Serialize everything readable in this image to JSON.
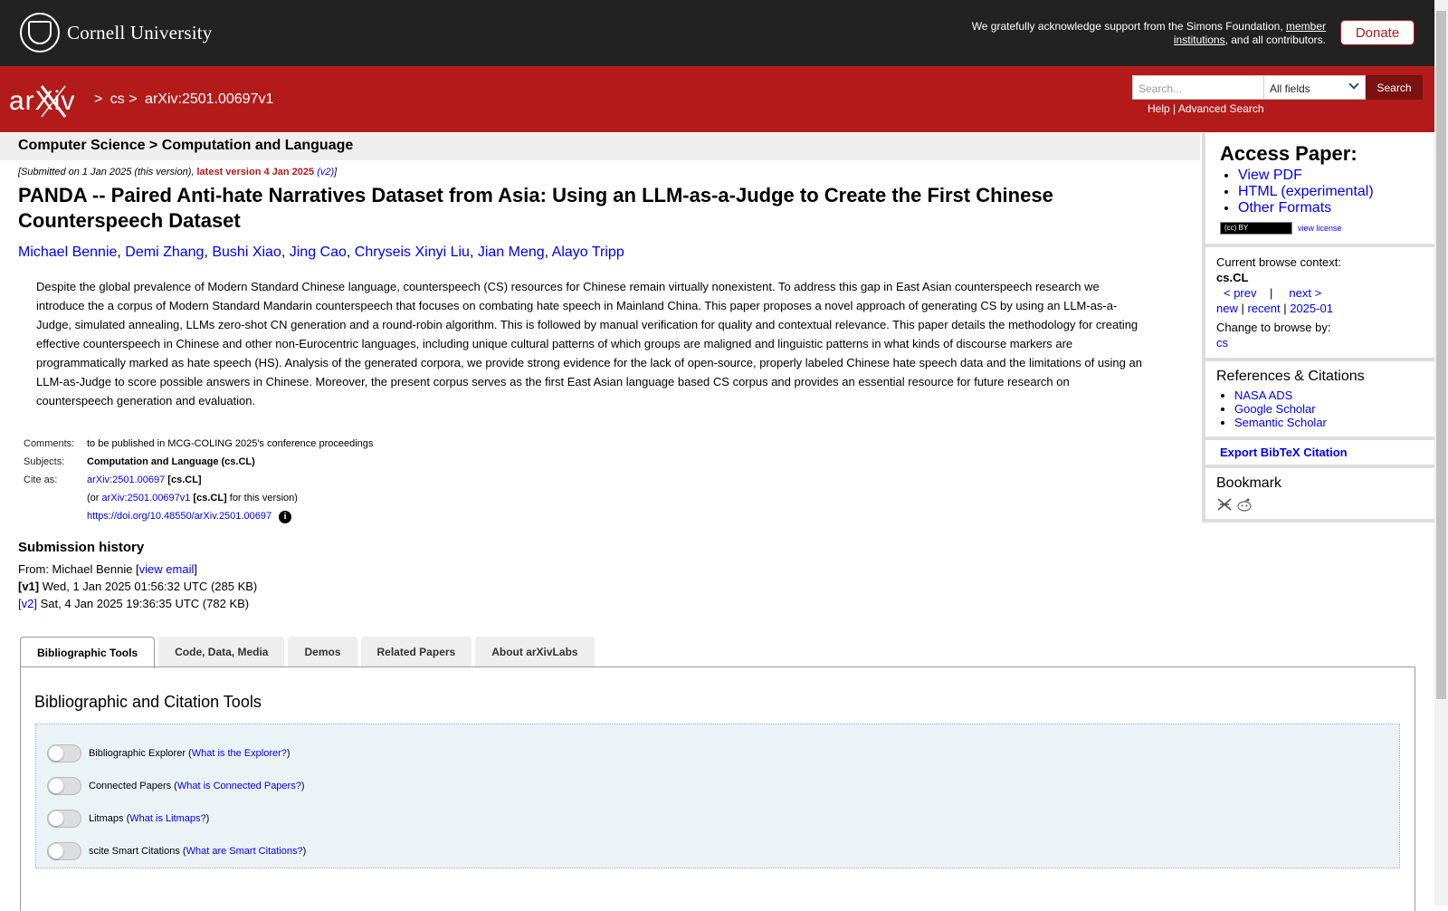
{
  "cornell": {
    "name": "Cornell University",
    "support_pre": "We gratefully acknowledge support from the Simons Foundation, ",
    "support_link": "member institutions",
    "support_post": ", and all contributors.",
    "donate_label": "Donate"
  },
  "arxiv_bar": {
    "logo_text": "arXiv",
    "crumb_sep1": ">",
    "crumb_cs": "cs",
    "crumb_sep2": ">",
    "crumb_id": "arXiv:2501.00697v1",
    "search_placeholder": "Search...",
    "field_selected": "All fields",
    "search_label": "Search",
    "help_label": "Help",
    "help_sep": " | ",
    "advanced_label": "Advanced Search"
  },
  "subject_header": "Computer Science > Computation and Language",
  "paper": {
    "dateline_pre": "[Submitted on 1 Jan 2025 (this version), ",
    "dateline_latest": "latest version 4 Jan 2025",
    "dateline_v2": "(v2)",
    "dateline_post": "]",
    "title": "PANDA -- Paired Anti-hate Narratives Dataset from Asia: Using an LLM-as-a-Judge to Create the First Chinese Counterspeech Dataset",
    "authors": [
      "Michael Bennie",
      "Demi Zhang",
      "Bushi Xiao",
      "Jing Cao",
      "Chryseis Xinyi Liu",
      "Jian Meng",
      "Alayo Tripp"
    ],
    "abstract": "Despite the global prevalence of Modern Standard Chinese language, counterspeech (CS) resources for Chinese remain virtually nonexistent. To address this gap in East Asian counterspeech research we introduce the a corpus of Modern Standard Mandarin counterspeech that focuses on combating hate speech in Mainland China. This paper proposes a novel approach of generating CS by using an LLM-as-a-Judge, simulated annealing, LLMs zero-shot CN generation and a round-robin algorithm. This is followed by manual verification for quality and contextual relevance. This paper details the methodology for creating effective counterspeech in Chinese and other non-Eurocentric languages, including unique cultural patterns of which groups are maligned and linguistic patterns in what kinds of discourse markers are programmatically marked as hate speech (HS). Analysis of the generated corpora, we provide strong evidence for the lack of open-source, properly labeled Chinese hate speech data and the limitations of using an LLM-as-Judge to score possible answers in Chinese. Moreover, the present corpus serves as the first East Asian language based CS corpus and provides an essential resource for future research on counterspeech generation and evaluation."
  },
  "meta": {
    "comments_label": "Comments:",
    "comments": "to be published in MCG-COLING 2025's conference proceedings",
    "subjects_label": "Subjects:",
    "subjects": "Computation and Language (cs.CL)",
    "cite_label": "Cite as:",
    "cite_id": "arXiv:2501.00697",
    "cite_cat": "[cs.CL]",
    "or_pre": "(or ",
    "or_id": "arXiv:2501.00697v1",
    "or_cat": "[cs.CL]",
    "or_post": " for this version)",
    "doi": "https://doi.org/10.48550/arXiv.2501.00697",
    "info_glyph": "i"
  },
  "history": {
    "heading": "Submission history",
    "from_pre": "From: Michael Bennie [",
    "view_email": "view email",
    "from_post": "]",
    "v1_label": "[v1]",
    "v1_text": " Wed, 1 Jan 2025 01:56:32 UTC (285 KB)",
    "v2_label": "[v2]",
    "v2_text": " Sat, 4 Jan 2025 19:36:35 UTC (782 KB)"
  },
  "sidebar": {
    "access_heading": "Access Paper:",
    "access_links": [
      "View PDF",
      "HTML (experimental)",
      "Other Formats"
    ],
    "cc_label": "(cc) BY",
    "view_license": "view license",
    "browse_context_label": "Current browse context:",
    "browse_context": "cs.CL",
    "prev": "< prev",
    "nav_sep": "|",
    "next": "next >",
    "new": "new",
    "recent": "recent",
    "month": "2025-01",
    "change_label": "Change to browse by:",
    "change_cs": "cs",
    "refs_heading": "References & Citations",
    "refs_links": [
      "NASA ADS",
      "Google Scholar",
      "Semantic Scholar"
    ],
    "bibtex": "Export BibTeX Citation",
    "bookmark_heading": "Bookmark",
    "bookmark_icons": [
      "bibsonomy-icon",
      "reddit-icon"
    ]
  },
  "tabs": [
    "Bibliographic Tools",
    "Code, Data, Media",
    "Demos",
    "Related Papers",
    "About arXivLabs"
  ],
  "tools": {
    "heading": "Bibliographic and Citation Tools",
    "items": [
      {
        "name": "Bibliographic Explorer",
        "link": "What is the Explorer?"
      },
      {
        "name": "Connected Papers",
        "link": "What is Connected Papers?"
      },
      {
        "name": "Litmaps",
        "link": "What is Litmaps?"
      },
      {
        "name": "scite Smart Citations",
        "link": "What are Smart Citations?"
      }
    ]
  },
  "colors": {
    "arxiv_red": "#b31b1b",
    "cornell_dark": "#222222",
    "link": "#0000ee"
  }
}
